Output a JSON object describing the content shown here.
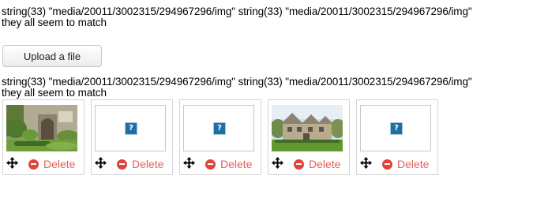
{
  "debug_line_1": "string(33) \"media/20011/3002315/294967296/img\" string(33) \"media/20011/3002315/294967296/img\"\nthey all seem to match",
  "upload_button_label": "Upload a file",
  "debug_line_2": "string(33) \"media/20011/3002315/294967296/img\" string(33) \"media/20011/3002315/294967296/img\"\nthey all seem to match",
  "images": [
    {
      "kind": "photo",
      "subject": "stone cottage doorway with garden",
      "delete_label": "Delete"
    },
    {
      "kind": "broken",
      "icon_text": "?",
      "delete_label": "Delete"
    },
    {
      "kind": "broken",
      "icon_text": "?",
      "delete_label": "Delete"
    },
    {
      "kind": "photo",
      "subject": "stone manor house with lawn",
      "delete_label": "Delete"
    },
    {
      "kind": "broken",
      "icon_text": "?",
      "delete_label": "Delete"
    }
  ],
  "icons": {
    "move": "move-arrows-icon",
    "delete": "minus-circle-icon",
    "broken": "broken-image-icon"
  },
  "colors": {
    "delete_text": "#e0625c",
    "delete_icon": "#e0443d",
    "broken_icon": "#1f6fa7"
  }
}
